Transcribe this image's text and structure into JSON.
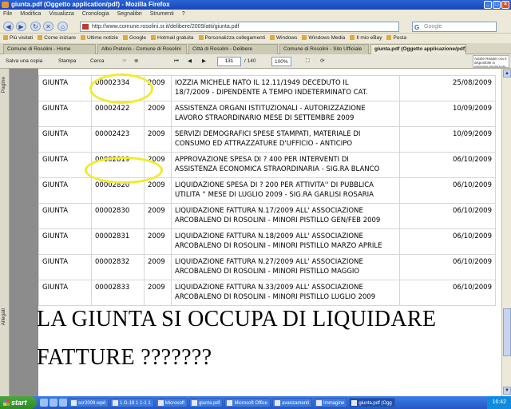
{
  "window": {
    "title": "giunta.pdf (Oggetto application/pdf) - Mozilla Firefox"
  },
  "menu": [
    "File",
    "Modifica",
    "Visualizza",
    "Cronologia",
    "Segnalibri",
    "Strumenti",
    "?"
  ],
  "navbar": {
    "url": "http://www.comune.rosolini.sr.it/delibere/2009/atti/giunta.pdf",
    "search_placeholder": "Google"
  },
  "bookmarks": [
    "Più visitati",
    "Come iniziare",
    "Ultime notizie",
    "Google",
    "Hotmail gratuita",
    "Personalizza collegamenti",
    "Windows",
    "Windows Media",
    "Il mio eBay",
    "Posta"
  ],
  "tabs": [
    {
      "label": "Comune di Rosolini - Home",
      "active": false
    },
    {
      "label": "Albo Pretorio - Comune di Rosolini",
      "active": false
    },
    {
      "label": "Città di Rosolini - Delibere",
      "active": false
    },
    {
      "label": "Comune di Rosolini - Sito Ufficiale",
      "active": false
    },
    {
      "label": "giunta.pdf (Oggetto applicazione/pdf)",
      "active": true
    }
  ],
  "pdf_toolbar": {
    "save_label": "Salva una copia",
    "print_label": "Stampa",
    "find_label": "Cerca",
    "page_value": "131",
    "page_total": "/ 140",
    "zoom_value": "100%",
    "adobe_text": "Adobe Reader ora è disponibile in versione aggiornata"
  },
  "sidepanel": {
    "pages_label": "Pagine",
    "attachments_label": "Allegati"
  },
  "rows": [
    {
      "org": "GIUNTA",
      "num": "00002334",
      "year": "2009",
      "desc": "IOZZIA MICHELE NATO IL 12.11/1949 DECEDUTO IL\n18/7/2009 - DIPENDENTE A TEMPO INDETERMINATO CAT.",
      "date": "25/08/2009"
    },
    {
      "org": "GIUNTA",
      "num": "00002422",
      "year": "2009",
      "desc": "ASSISTENZA ORGANI ISTITUZIONALI - AUTORIZZAZIONE\nLAVORO STRAORDINARIO MESE DI SETTEMBRE 2009",
      "date": "10/09/2009"
    },
    {
      "org": "GIUNTA",
      "num": "00002423",
      "year": "2009",
      "desc": "SERVIZI DEMOGRAFICI SPESE STAMPATI, MATERIALE DI\nCONSUMO ED ATTRAZZATURE D'UFFICIO - ANTICIPO",
      "date": "10/09/2009"
    },
    {
      "org": "GIUNTA",
      "num": "00002819",
      "year": "2009",
      "desc": "APPROVAZIONE SPESA DI ? 400 PER INTERVENTI DI\nASSISTENZA ECONOMICA STRAORDINARIA - SIG.RA BLANCO",
      "date": "06/10/2009"
    },
    {
      "org": "GIUNTA",
      "num": "00002820",
      "year": "2009",
      "desc": "LIQUIDAZIONE SPESA DI ? 200 PER ATTIVITA'' DI PUBBLICA\nUTILITA '' MESE DI LUGLIO 2009 - SIG.RA GARLISI ROSARIA",
      "date": "06/10/2009"
    },
    {
      "org": "GIUNTA",
      "num": "00002830",
      "year": "2009",
      "desc": "LIQUIDAZIONE FATTURA N.17/2009 ALL' ASSOCIAZIONE\nARCOBALENO DI ROSOLINI - MINORI PISTILLO GEN/FEB 2009",
      "date": "06/10/2009"
    },
    {
      "org": "GIUNTA",
      "num": "00002831",
      "year": "2009",
      "desc": "LIQUIDAZIONE FATTURA N.18/2009 ALL' ASSOCIAZIONE\nARCOBALENO DI ROSOLINI - MINORI PISTILLO MARZO APRILE",
      "date": "06/10/2009"
    },
    {
      "org": "GIUNTA",
      "num": "00002832",
      "year": "2009",
      "desc": "LIQUIDAZIONE FATTURA N.27/2009 ALL' ASSOCIAZIONE\nARCOBALENO DI ROSOLINI - MINORI PISTILLO MAGGIO",
      "date": "06/10/2009"
    },
    {
      "org": "GIUNTA",
      "num": "00002833",
      "year": "2009",
      "desc": "LIQUIDAZIONE FATTURA N.33/2009 ALL' ASSOCIAZIONE\nARCOBALENO DI ROSOLINI - MINORI PISTILLO LUGLIO 2009",
      "date": "06/10/2009"
    }
  ],
  "caption": {
    "line1": "LA GIUNTA SI OCCUPA DI LIQUIDARE",
    "line2": "FATTURE ???????"
  },
  "taskbar": {
    "start_label": "start",
    "tasks": [
      "scr2009.wpd",
      "1 G-19 1 1-1 1",
      "Microsoft",
      "giunta.pdf",
      "Microsoft Office",
      "avanzamenti",
      "Immagine",
      "giunta.pdf (Ogg"
    ],
    "clock": "16:42"
  },
  "colors": {
    "highlight_circle": "#f2ea2e"
  }
}
